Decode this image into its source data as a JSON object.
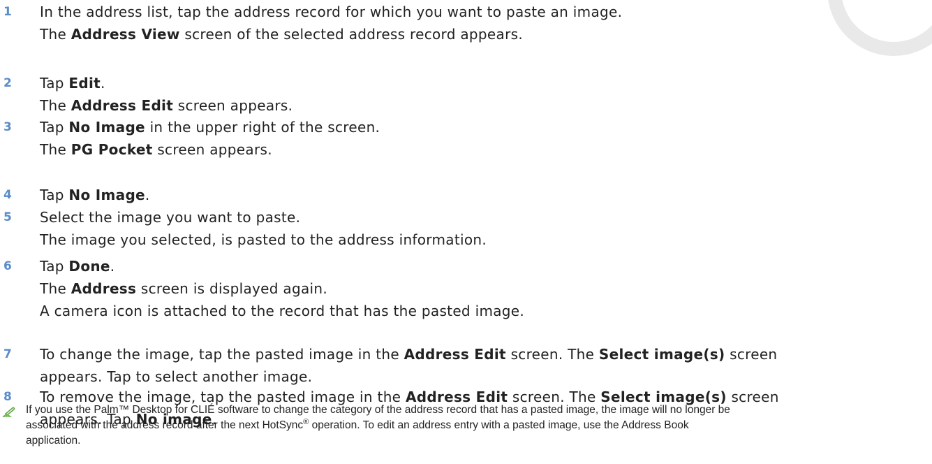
{
  "steps": [
    {
      "number": "1",
      "lines": [
        [
          {
            "t": "In the address list, tap the address record for which you want to paste an image."
          }
        ],
        [
          {
            "t": "The "
          },
          {
            "t": "Address View",
            "b": true
          },
          {
            "t": " screen of the selected address record appears."
          }
        ]
      ]
    },
    {
      "number": "2",
      "lines": [
        [
          {
            "t": "Tap "
          },
          {
            "t": "Edit",
            "b": true
          },
          {
            "t": "."
          }
        ],
        [
          {
            "t": "The "
          },
          {
            "t": "Address Edit",
            "b": true
          },
          {
            "t": " screen appears."
          }
        ]
      ]
    },
    {
      "number": "3",
      "lines": [
        [
          {
            "t": "Tap "
          },
          {
            "t": "No Image",
            "b": true
          },
          {
            "t": " in the upper right of the screen."
          }
        ],
        [
          {
            "t": "The "
          },
          {
            "t": "PG Pocket",
            "b": true
          },
          {
            "t": " screen appears."
          }
        ]
      ]
    },
    {
      "number": "4",
      "lines": [
        [
          {
            "t": "Tap "
          },
          {
            "t": "No Image",
            "b": true
          },
          {
            "t": "."
          }
        ]
      ]
    },
    {
      "number": "5",
      "lines": [
        [
          {
            "t": "Select the image you want to paste."
          }
        ],
        [
          {
            "t": "The image you selected, is pasted to the address information."
          }
        ]
      ]
    },
    {
      "number": "6",
      "lines": [
        [
          {
            "t": "Tap "
          },
          {
            "t": "Done",
            "b": true
          },
          {
            "t": "."
          }
        ],
        [
          {
            "t": "The "
          },
          {
            "t": "Address",
            "b": true
          },
          {
            "t": " screen is displayed again."
          }
        ],
        [
          {
            "t": "A camera icon is attached to the record that has the pasted image."
          }
        ]
      ]
    },
    {
      "number": "7",
      "lines": [
        [
          {
            "t": "To change the image, tap the pasted image in the "
          },
          {
            "t": "Address Edit",
            "b": true
          },
          {
            "t": " screen. The "
          },
          {
            "t": "Select image(s)",
            "b": true
          },
          {
            "t": " screen"
          }
        ],
        [
          {
            "t": "appears. Tap to select another image."
          }
        ]
      ]
    },
    {
      "number": "8",
      "lines": [
        [
          {
            "t": "To remove the image, tap the pasted image in the "
          },
          {
            "t": "Address Edit",
            "b": true
          },
          {
            "t": " screen. The "
          },
          {
            "t": "Select image(s)",
            "b": true
          },
          {
            "t": " screen"
          }
        ],
        [
          {
            "t": "appears. Tap "
          },
          {
            "t": "No image",
            "b": true
          },
          {
            "t": "."
          }
        ]
      ]
    }
  ],
  "note": {
    "icon": "pencil-note-icon",
    "lines": [
      [
        {
          "t": "If you use the Palm™ Desktop for CLIÉ software to change the category of the address record that has a pasted image, the image will no longer be"
        }
      ],
      [
        {
          "t": "associated with the address record after the next HotSync"
        },
        {
          "t": "®",
          "sup": true
        },
        {
          "t": " operation. To edit an address entry with a pasted image, use the Address Book"
        }
      ],
      [
        {
          "t": "application."
        }
      ]
    ]
  },
  "colors": {
    "step_number": "#5a8cc8",
    "text": "#222222",
    "note_icon": "#5aa83c",
    "decoration": "#e9e9e9"
  }
}
